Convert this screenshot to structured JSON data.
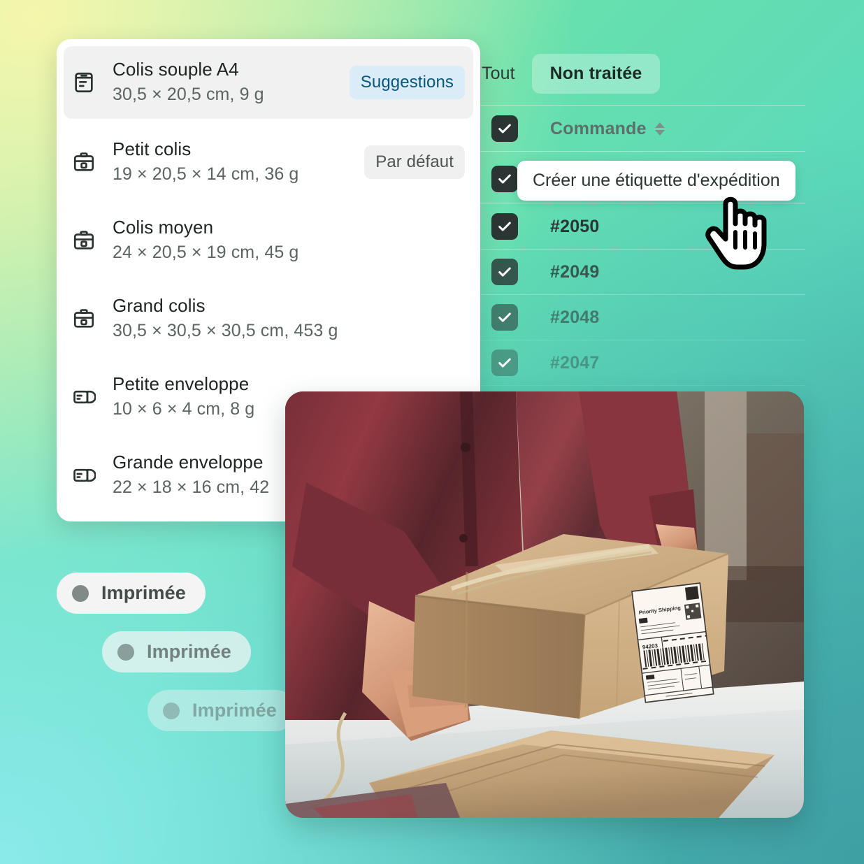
{
  "theme": {
    "bg_top_left": "#f4f6ac",
    "bg_top_right": "#66e0ae",
    "bg_bottom_left": "#8aeaea",
    "bg_bottom_right": "#3fa0a4",
    "accent_blue_bg": "#daecf8",
    "accent_blue_text": "#0a5679",
    "checkbox_dark": "#2b3533",
    "card_white": "#ffffff"
  },
  "package_picker": {
    "items": [
      {
        "icon": "flat-package-icon",
        "title": "Colis souple A4",
        "dimensions": "30,5 × 20,5 cm, 9 g",
        "badge": "Suggestions",
        "badge_style": "blue",
        "selected": true
      },
      {
        "icon": "box-icon",
        "title": "Petit colis",
        "dimensions": "19 × 20,5 × 14 cm, 36 g",
        "badge": "Par défaut",
        "badge_style": "grey",
        "selected": false
      },
      {
        "icon": "box-icon",
        "title": "Colis moyen",
        "dimensions": "24 × 20,5 × 19 cm, 45 g",
        "badge": "",
        "badge_style": "",
        "selected": false
      },
      {
        "icon": "box-icon",
        "title": "Grand colis",
        "dimensions": "30,5 × 30,5 × 30,5 cm, 453 g",
        "badge": "",
        "badge_style": "",
        "selected": false
      },
      {
        "icon": "envelope-icon",
        "title": "Petite enveloppe",
        "dimensions": "10 × 6 × 4 cm, 8 g",
        "badge": "",
        "badge_style": "",
        "selected": false
      },
      {
        "icon": "envelope-icon",
        "title": "Grande enveloppe",
        "dimensions": "22 × 18 × 16 cm, 42",
        "badge": "",
        "badge_style": "",
        "selected": false
      }
    ]
  },
  "orders": {
    "tabs": [
      {
        "label": "Tout",
        "active": false
      },
      {
        "label": "Non traitée",
        "active": true
      }
    ],
    "column_header": "Commande",
    "sort_icon": "sort-updown-icon",
    "tooltip": "Créer une étiquette d'expédition",
    "cursor_icon": "pointing-hand-cursor",
    "rows": [
      {
        "id": "",
        "checked": true,
        "fade": 0,
        "is_header": true
      },
      {
        "id": "",
        "checked": true,
        "fade": 0,
        "is_header": false
      },
      {
        "id": "#2050",
        "checked": true,
        "fade": 0,
        "is_header": false
      },
      {
        "id": "#2049",
        "checked": true,
        "fade": 1,
        "is_header": false
      },
      {
        "id": "#2048",
        "checked": true,
        "fade": 2,
        "is_header": false
      },
      {
        "id": "#2047",
        "checked": true,
        "fade": 3,
        "is_header": false
      }
    ]
  },
  "status_chips": [
    {
      "label": "Imprimée",
      "dot": "status-dot"
    },
    {
      "label": "Imprimée",
      "dot": "status-dot"
    },
    {
      "label": "Imprimée",
      "dot": "status-dot"
    }
  ],
  "photo": {
    "alt": "Person in maroon shirt placing a taped cardboard box with a shipping label on a white table next to kraft envelopes",
    "label_title": "Priority Shipping",
    "label_code": "94203"
  }
}
